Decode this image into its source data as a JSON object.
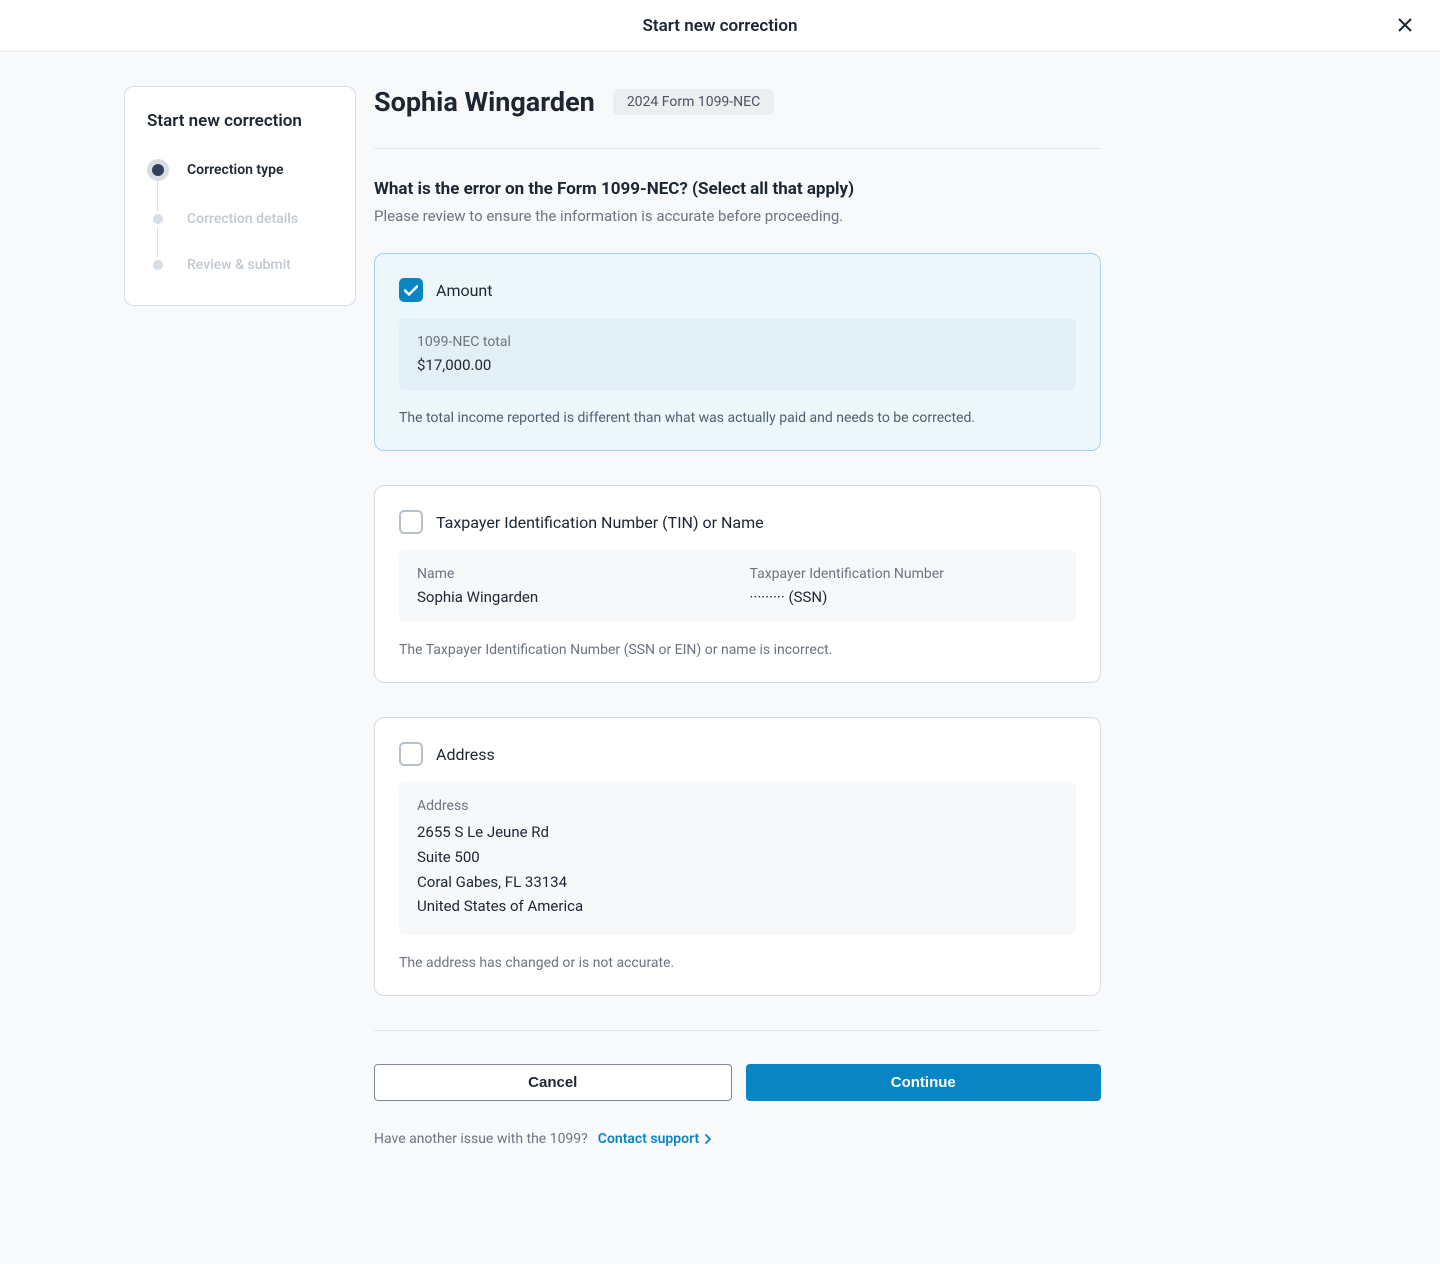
{
  "header": {
    "title": "Start new correction"
  },
  "sidebar": {
    "title": "Start new correction",
    "steps": [
      {
        "label": "Correction type",
        "active": true
      },
      {
        "label": "Correction details",
        "active": false
      },
      {
        "label": "Review & submit",
        "active": false
      }
    ]
  },
  "main": {
    "person_name": "Sophia Wingarden",
    "form_badge": "2024 Form 1099-NEC",
    "question_title": "What is the error on the Form 1099-NEC? (Select all that apply)",
    "question_subtitle": "Please review to ensure the information is accurate before proceeding.",
    "options": {
      "amount": {
        "title": "Amount",
        "checked": true,
        "total_label": "1099-NEC total",
        "total_value": "$17,000.00",
        "description": "The total income reported is different than what was actually paid and needs to be corrected."
      },
      "tin": {
        "title": "Taxpayer Identification Number (TIN) or Name",
        "checked": false,
        "name_label": "Name",
        "name_value": "Sophia Wingarden",
        "tin_label": "Taxpayer Identification Number",
        "tin_value": "········· (SSN)",
        "description": "The Taxpayer Identification Number (SSN or EIN) or name is incorrect."
      },
      "address": {
        "title": "Address",
        "checked": false,
        "address_label": "Address",
        "address_lines": [
          "2655 S Le Jeune Rd",
          "Suite 500",
          "Coral Gabes, FL 33134",
          "United States of America"
        ],
        "description": "The address has changed or is not accurate."
      }
    },
    "buttons": {
      "cancel": "Cancel",
      "continue": "Continue"
    },
    "support": {
      "text": "Have another issue with the 1099?",
      "link": "Contact support"
    }
  }
}
